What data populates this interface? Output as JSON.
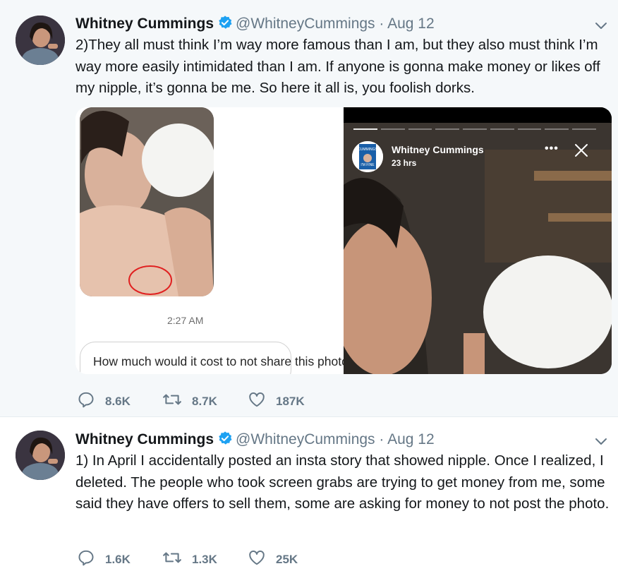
{
  "tweets": [
    {
      "name": "Whitney Cummings",
      "handle": "@WhitneyCummings",
      "separator": "·",
      "date": "Aug 12",
      "text": "2)They all must think I’m way more famous than I am, but they also must think I’m way more easily intimidated than I am. If anyone is gonna make money or likes off my nipple, it’s gonna be me. So here it all is, you foolish dorks.",
      "media": {
        "chat_time": "2:27 AM",
        "chat_message": "How much would it cost to not share this photo?",
        "story_name": "Whitney Cummings",
        "story_time": "23 hrs",
        "story_more": "•••",
        "story_book_line1": "CUMMINGS",
        "story_book_line2": "I'M FINE"
      },
      "replies": "8.6K",
      "retweets": "8.7K",
      "likes": "187K"
    },
    {
      "name": "Whitney Cummings",
      "handle": "@WhitneyCummings",
      "separator": "·",
      "date": "Aug 12",
      "text": "1) In April I accidentally posted an insta story that showed nipple. Once I realized, I deleted. The people who took screen grabs are trying to get money from me, some said they have offers to sell them, some are asking for money to not post the photo.",
      "replies": "1.6K",
      "retweets": "1.3K",
      "likes": "25K"
    }
  ],
  "icons": {
    "reply": "reply-icon",
    "retweet": "retweet-icon",
    "like": "like-icon",
    "verified": "verified-badge-icon",
    "caret": "chevron-down-icon",
    "close": "close-icon"
  },
  "colors": {
    "verified": "#1da1f2",
    "secondary_text": "#657786",
    "tweet_highlight_bg": "#f5f8fa"
  }
}
